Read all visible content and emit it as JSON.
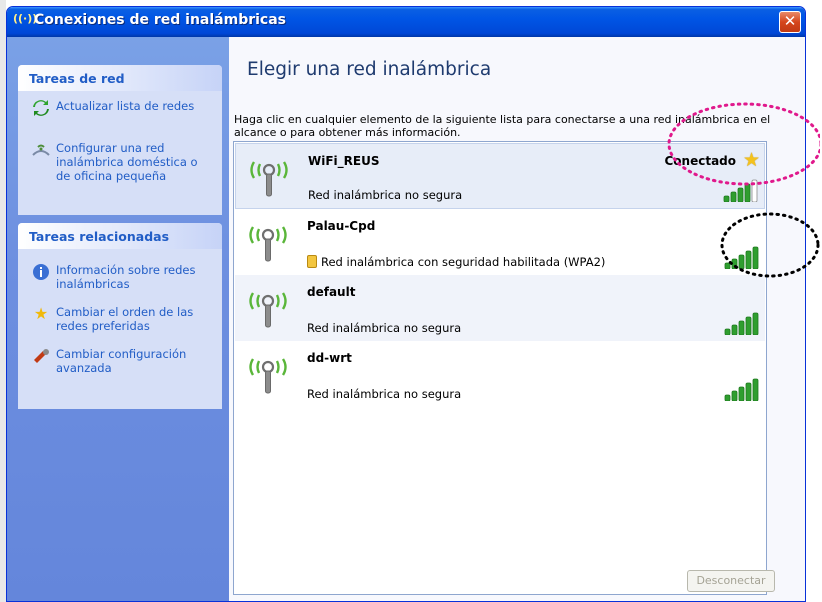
{
  "window": {
    "title": "Conexiones de red inalámbricas",
    "close_symbol": "✕"
  },
  "sidebar": {
    "network_tasks": {
      "header": "Tareas de red",
      "items": [
        {
          "icon": "refresh-icon",
          "label": "Actualizar lista de redes"
        },
        {
          "icon": "wireless-setup-icon",
          "label": "Configurar una red inalámbrica doméstica o de oficina pequeña"
        }
      ]
    },
    "related_tasks": {
      "header": "Tareas relacionadas",
      "items": [
        {
          "icon": "info-icon",
          "label": "Información sobre redes inalámbricas"
        },
        {
          "icon": "star-icon",
          "label": "Cambiar el orden de las redes preferidas"
        },
        {
          "icon": "advanced-settings-icon",
          "label": "Cambiar configuración avanzada"
        }
      ]
    }
  },
  "main": {
    "heading": "Elegir una red inalámbrica",
    "description": "Haga clic en cualquier elemento de la siguiente lista para conectarse a una red inalámbrica en el alcance o para obtener más información.",
    "networks": [
      {
        "name": "WiFi_REUS",
        "status": "Red inalámbrica no segura",
        "connected_label": "Conectado",
        "secured": false,
        "signal_bars": 4
      },
      {
        "name": "Palau-Cpd",
        "status": "Red inalámbrica con seguridad habilitada (WPA2)",
        "secured": true,
        "signal_bars": 5
      },
      {
        "name": "default",
        "status": "Red inalámbrica no segura",
        "secured": false,
        "signal_bars": 5
      },
      {
        "name": "dd-wrt",
        "status": "Red inalámbrica no segura",
        "secured": false,
        "signal_bars": 5
      }
    ],
    "disconnect_label": "Desconectar"
  },
  "colors": {
    "titlebar": "#0055e5",
    "sidebar_bg": "#6d8fe0",
    "task_link": "#215dc6",
    "signal_green": "#2f9e2f",
    "annotation_magenta": "#e0198c",
    "annotation_black": "#000000"
  }
}
